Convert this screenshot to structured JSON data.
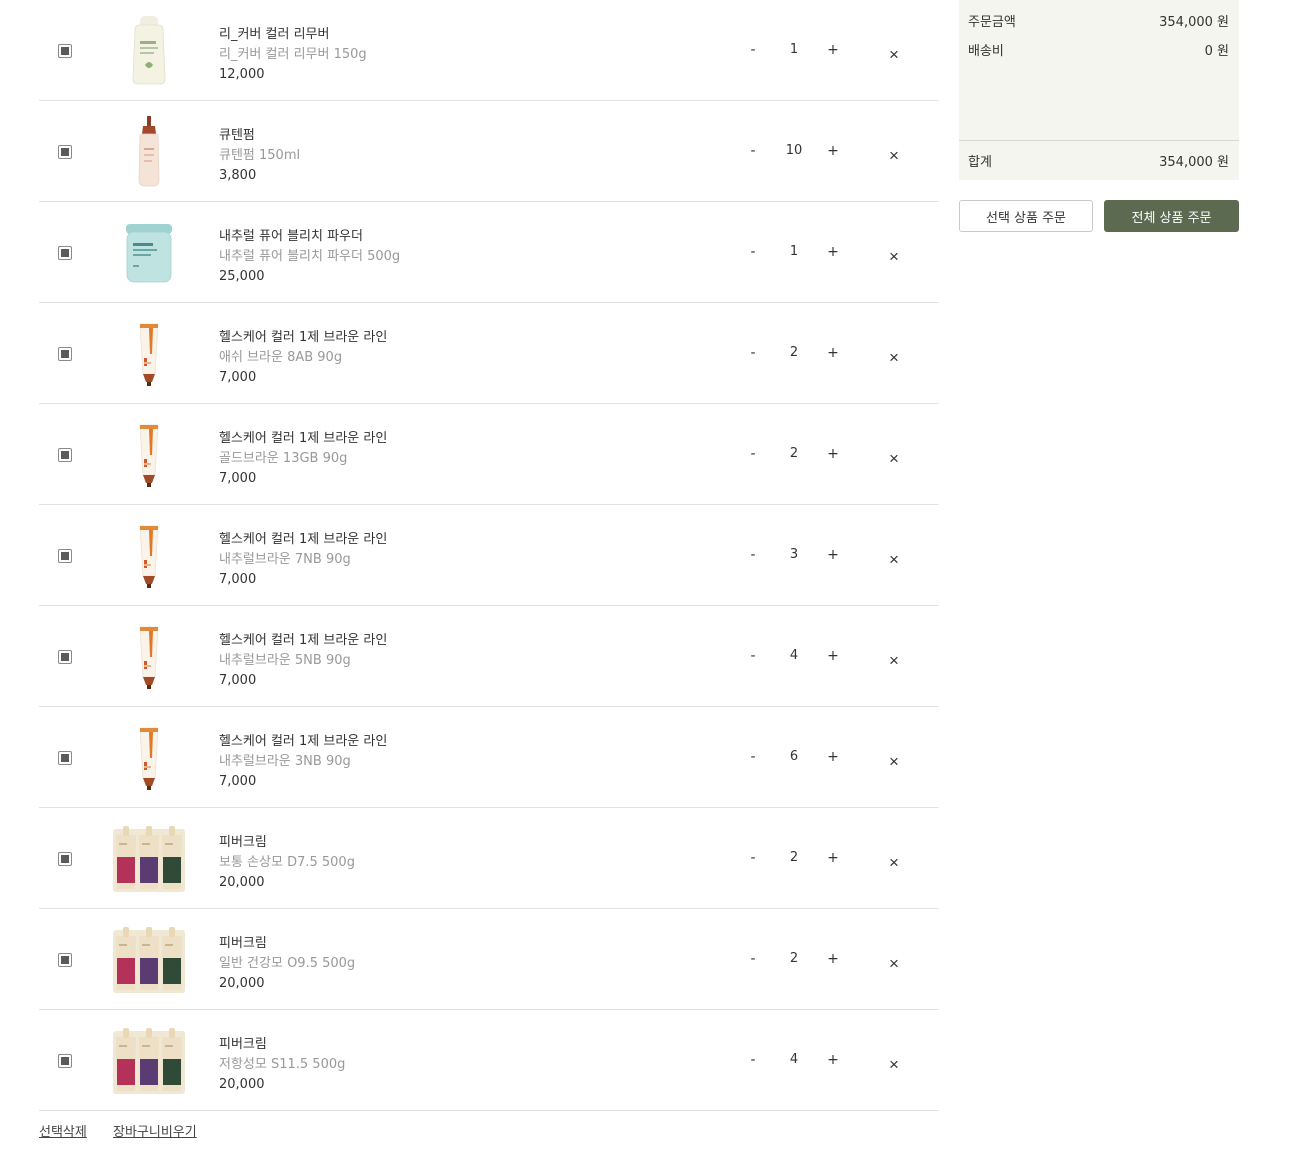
{
  "cart": {
    "items": [
      {
        "name": "리_커버 컬러 리무버",
        "option": "리_커버 컬러 리무버 150g",
        "price": "12,000",
        "qty": "1",
        "image": "bottle-image"
      },
      {
        "name": "큐텐펌",
        "option": "큐텐펌 150ml",
        "price": "3,800",
        "qty": "10",
        "image": "dropper-bottle-image"
      },
      {
        "name": "내추럴 퓨어 블리치 파우더",
        "option": "내추럴 퓨어 블리치 파우더 500g",
        "price": "25,000",
        "qty": "1",
        "image": "jar-image"
      },
      {
        "name": "헬스케어 컬러 1제 브라운 라인",
        "option": "애쉬 브라운 8AB 90g",
        "price": "7,000",
        "qty": "2",
        "image": "tube-image"
      },
      {
        "name": "헬스케어 컬러 1제 브라운 라인",
        "option": "골드브라운 13GB 90g",
        "price": "7,000",
        "qty": "2",
        "image": "tube-image"
      },
      {
        "name": "헬스케어 컬러 1제 브라운 라인",
        "option": "내추럴브라운 7NB 90g",
        "price": "7,000",
        "qty": "3",
        "image": "tube-image"
      },
      {
        "name": "헬스케어 컬러 1제 브라운 라인",
        "option": "내추럴브라운 5NB 90g",
        "price": "7,000",
        "qty": "4",
        "image": "tube-image"
      },
      {
        "name": "헬스케어 컬러 1제 브라운 라인",
        "option": "내추럴브라운 3NB 90g",
        "price": "7,000",
        "qty": "6",
        "image": "tube-image"
      },
      {
        "name": "피버크림",
        "option": "보통 손상모 D7.5 500g",
        "price": "20,000",
        "qty": "2",
        "image": "pouch-set-image"
      },
      {
        "name": "피버크림",
        "option": "일반 건강모 O9.5 500g",
        "price": "20,000",
        "qty": "2",
        "image": "pouch-set-image"
      },
      {
        "name": "피버크림",
        "option": "저항성모 S11.5 500g",
        "price": "20,000",
        "qty": "4",
        "image": "pouch-set-image"
      }
    ],
    "minus_label": "-",
    "plus_label": "+",
    "delete_label": "×",
    "actions": {
      "delete_selected": "선택삭제",
      "empty_cart": "장바구니비우기"
    }
  },
  "summary": {
    "order_amount_label": "주문금액",
    "order_amount_value": "354,000 원",
    "shipping_label": "배송비",
    "shipping_value": "0 원",
    "total_label": "합계",
    "total_value": "354,000 원"
  },
  "buttons": {
    "order_selected": "선택 상품 주문",
    "order_all": "전체 상품 주문"
  },
  "colors": {
    "accent": "#5b6a50",
    "summary_bg": "#f5f5ef"
  }
}
